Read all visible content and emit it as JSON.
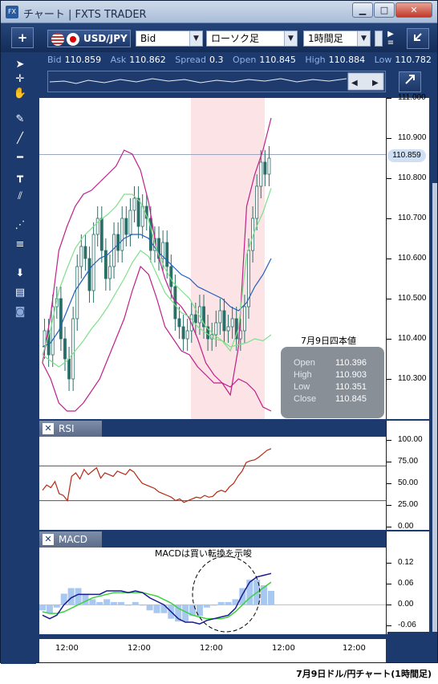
{
  "window": {
    "icon": "FX",
    "title": "チャート | FXTS TRADER",
    "minimize": "▁",
    "maximize": "□",
    "close": "✕"
  },
  "toolbar": {
    "add_label": "+",
    "symbol": "USD/JPY",
    "price_type": "Bid",
    "chart_type": "ローソク足",
    "timeframe": "1時間足",
    "expand_icon": "expand-icon"
  },
  "quote": {
    "bid_label": "Bid",
    "bid": "110.859",
    "ask_label": "Ask",
    "ask": "110.862",
    "spread_label": "Spread",
    "spread": "0.3",
    "open_label": "Open",
    "open": "110.845",
    "high_label": "High",
    "high": "110.884",
    "low_label": "Low",
    "low": "110.782"
  },
  "tools": [
    "cursor-icon",
    "crosshair-icon",
    "hand-icon",
    "pen-icon",
    "trendline-icon",
    "hline-icon",
    "vline-icon",
    "channel-icon",
    "fibonacci-icon",
    "text-lines-icon",
    "download-icon",
    "list-icon",
    "camera-icon"
  ],
  "main_chart": {
    "current_price": "110.859",
    "annotation": "7月9日四本値",
    "ohlc": {
      "open_label": "Open",
      "open": "110.396",
      "high_label": "High",
      "high": "110.903",
      "low_label": "Low",
      "low": "110.351",
      "close_label": "Close",
      "close": "110.845"
    }
  },
  "rsi": {
    "tab_label": "RSI",
    "close": "✕"
  },
  "macd": {
    "tab_label": "MACD",
    "close": "✕",
    "annotation": "MACDは買い転換を示唆"
  },
  "time_axis": [
    "12:00",
    "12:00",
    "12:00",
    "12:00",
    "12:00"
  ],
  "caption": "7月9日ドル/円チャート(1時間足)",
  "colors": {
    "frame": "#1c3a6e",
    "bollinger_outer": "#c0208a",
    "bollinger_inner": "#7fe08a",
    "mid": "#1f5fbf",
    "candle": "#2a6f6a",
    "highlight": "#fbe3e6",
    "rsi": "#b42a12",
    "macd": "#1a1a8f",
    "signal": "#3fd03f",
    "histogram": "#a8c8f0"
  },
  "chart_data": [
    {
      "type": "candlestick",
      "title": "USD/JPY",
      "ylim": [
        110.2,
        111.0
      ],
      "yticks": [
        110.3,
        110.4,
        110.5,
        110.6,
        110.7,
        110.8,
        110.9,
        111.0
      ],
      "ytick_labels": [
        "110.300",
        "110.400",
        "110.500",
        "110.600",
        "110.700",
        "110.800",
        "110.900",
        "111.000"
      ],
      "series": [
        {
          "values": [
            110.42,
            110.36,
            110.48,
            110.5,
            110.4,
            110.35,
            110.3,
            110.45,
            110.58,
            110.63,
            110.6,
            110.52,
            110.66,
            110.7,
            110.62,
            110.55,
            110.58,
            110.66,
            110.62,
            110.7,
            110.66,
            110.72,
            110.75,
            110.68,
            110.73,
            110.7,
            110.62,
            110.65,
            110.6,
            110.64,
            110.58,
            110.53,
            110.45,
            110.43,
            110.4,
            110.42,
            110.46,
            110.44,
            110.48,
            110.43,
            110.4,
            110.41,
            110.44,
            110.47,
            110.42,
            110.43,
            110.45,
            110.4,
            110.42,
            110.48,
            110.62,
            110.7,
            110.78,
            110.84,
            110.81,
            110.85
          ]
        },
        {
          "name": "upper",
          "values": [
            110.34,
            110.46,
            110.62,
            110.68,
            110.73,
            110.76,
            110.77,
            110.79,
            110.81,
            110.83,
            110.87,
            110.86,
            110.82,
            110.74,
            110.62,
            110.55,
            110.5,
            110.48,
            110.45,
            110.4,
            110.34,
            110.31,
            110.29,
            110.26,
            110.38,
            110.73,
            110.81,
            110.87,
            110.95
          ]
        },
        {
          "name": "lower",
          "values": [
            110.34,
            110.3,
            110.24,
            110.22,
            110.22,
            110.24,
            110.27,
            110.3,
            110.35,
            110.4,
            110.45,
            110.52,
            110.58,
            110.56,
            110.5,
            110.43,
            110.4,
            110.37,
            110.36,
            110.33,
            110.31,
            110.29,
            110.29,
            110.28,
            110.3,
            110.29,
            110.27,
            110.23,
            110.22
          ]
        },
        {
          "name": "mid",
          "values": [
            110.38,
            110.39,
            110.42,
            110.47,
            110.52,
            110.55,
            110.58,
            110.6,
            110.61,
            110.63,
            110.65,
            110.66,
            110.66,
            110.65,
            110.62,
            110.6,
            110.58,
            110.56,
            110.55,
            110.53,
            110.52,
            110.51,
            110.5,
            110.48,
            110.47,
            110.49,
            110.53,
            110.56,
            110.6
          ]
        }
      ]
    },
    {
      "type": "line",
      "title": "RSI",
      "ylim": [
        0,
        100
      ],
      "yticks": [
        0,
        25,
        50,
        75,
        100
      ],
      "ytick_labels": [
        "0.00",
        "25.00",
        "50.00",
        "75.00",
        "100.00"
      ],
      "series": [
        {
          "values": [
            42,
            48,
            45,
            52,
            38,
            36,
            30,
            58,
            62,
            55,
            66,
            60,
            64,
            68,
            56,
            62,
            60,
            58,
            64,
            62,
            60,
            66,
            63,
            56,
            50,
            48,
            46,
            44,
            40,
            38,
            36,
            34,
            30,
            32,
            28,
            30,
            32,
            34,
            33,
            36,
            34,
            35,
            40,
            42,
            40,
            46,
            50,
            58,
            64,
            74,
            76,
            77,
            80,
            84,
            88,
            90
          ]
        }
      ]
    },
    {
      "type": "line",
      "title": "MACD",
      "ylim": [
        -0.08,
        0.16
      ],
      "yticks": [
        -0.06,
        0.0,
        0.06,
        0.12
      ],
      "ytick_labels": [
        "-0.06",
        "0.00",
        "0.06",
        "0.12"
      ],
      "series": [
        {
          "values": [
            -0.03,
            -0.04,
            -0.03,
            0.0,
            0.02,
            0.03,
            0.03,
            0.03,
            0.03,
            0.04,
            0.04,
            0.04,
            0.035,
            0.04,
            0.035,
            0.02,
            0.01,
            0.0,
            -0.02,
            -0.04,
            -0.05,
            -0.05,
            -0.055,
            -0.045,
            -0.04,
            -0.035,
            -0.03,
            -0.01,
            0.03,
            0.065,
            0.08,
            0.085,
            0.09
          ]
        },
        {
          "values": [
            -0.02,
            -0.025,
            -0.025,
            -0.02,
            -0.01,
            0.0,
            0.01,
            0.02,
            0.025,
            0.03,
            0.035,
            0.035,
            0.035,
            0.035,
            0.035,
            0.03,
            0.025,
            0.015,
            0.005,
            -0.01,
            -0.02,
            -0.03,
            -0.035,
            -0.04,
            -0.04,
            -0.04,
            -0.035,
            -0.02,
            0.0,
            0.02,
            0.035,
            0.05,
            0.065
          ]
        }
      ]
    }
  ]
}
